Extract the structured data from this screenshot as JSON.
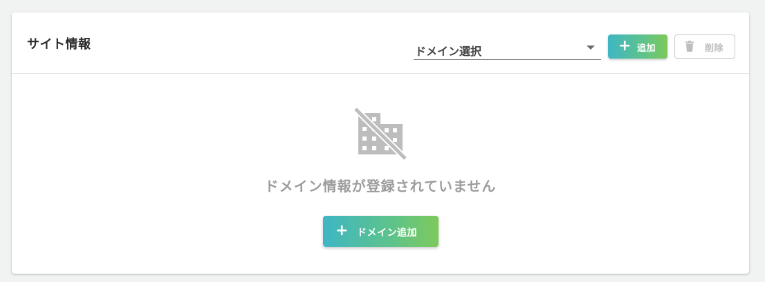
{
  "header": {
    "title": "サイト情報"
  },
  "domain_select": {
    "value": "ドメイン選択"
  },
  "toolbar": {
    "add_label": "追加",
    "delete_label": "削除",
    "delete_disabled": true
  },
  "empty_state": {
    "icon": "domain-disabled-icon",
    "message": "ドメイン情報が登録されていません",
    "add_domain_label": "ドメイン追加"
  },
  "colors": {
    "gradient_start": "#3fb6c4",
    "gradient_end": "#7ec95b",
    "page_background": "#f1f2f2",
    "empty_text": "#9c9c9c",
    "disabled": "#bdbdbd"
  }
}
